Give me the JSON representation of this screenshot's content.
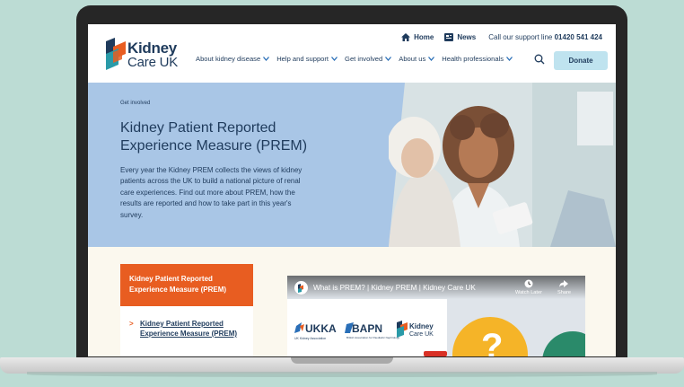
{
  "header": {
    "logo": {
      "line1": "Kidney",
      "line2": "Care UK"
    },
    "utility": {
      "home": "Home",
      "news": "News",
      "support_text": "Call our support line",
      "support_number": "01420 541 424"
    },
    "nav": [
      {
        "label": "About kidney disease"
      },
      {
        "label": "Help and support"
      },
      {
        "label": "Get involved"
      },
      {
        "label": "About us"
      },
      {
        "label": "Health professionals"
      }
    ],
    "donate_label": "Donate"
  },
  "hero": {
    "eyebrow": "Get involved",
    "title": "Kidney Patient Reported Experience Measure (PREM)",
    "body": "Every year the Kidney PREM collects the views of kidney patients across the UK to build a national picture of renal care experiences. Find out more about PREM, how the results are reported and how to take part in this year's survey."
  },
  "sidebar": {
    "title": "Kidney Patient Reported Experience Measure (PREM)",
    "link": "Kidney Patient Reported Experience Measure (PREM)"
  },
  "video": {
    "title": "What is PREM? | Kidney PREM | Kidney Care UK",
    "watch_later": "Watch Later",
    "share": "Share",
    "logo_ukka": "UKKA",
    "logo_ukka_sub": "UK Kidney Association",
    "logo_bapn": "BAPN",
    "logo_bapn_sub": "British Association for Paediatric Nephrology",
    "logo_kcuk_1": "Kidney",
    "logo_kcuk_2": "Care UK"
  },
  "colors": {
    "brand_navy": "#1f3b5c",
    "brand_orange": "#e85d21",
    "hero_blue": "#a9c6e6",
    "donate_bg": "#bfe3ef"
  }
}
